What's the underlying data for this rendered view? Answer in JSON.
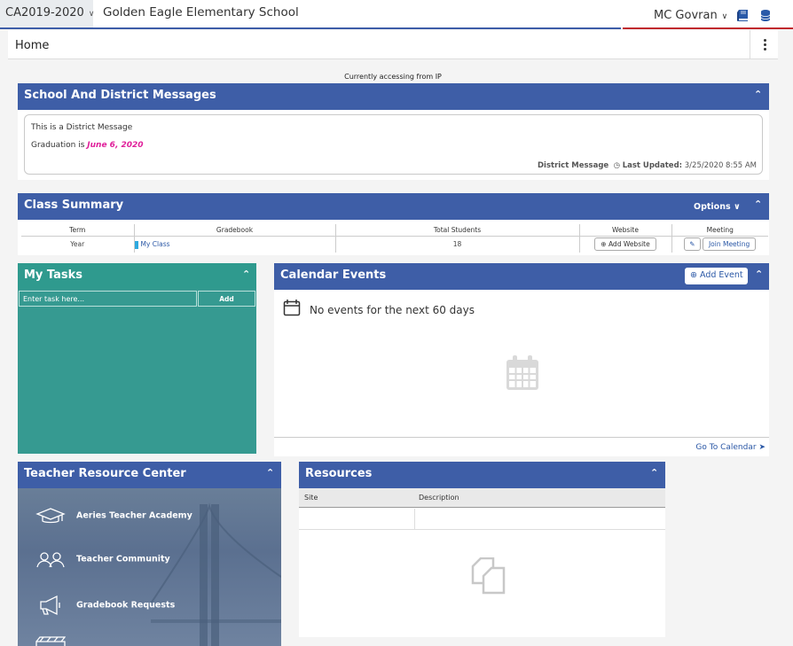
{
  "topbar": {
    "year": "CA2019-2020",
    "school": "Golden Eagle Elementary School",
    "user": "MC Govran",
    "icons": [
      "book-icon",
      "database-icon"
    ],
    "colors": {
      "blue": "#3d5da8",
      "red": "#c0292e"
    }
  },
  "nav": {
    "home": "Home"
  },
  "ip_note": "Currently accessing from IP",
  "messages": {
    "title": "School And District Messages",
    "line1": "This is a District Message",
    "line2_prefix": "Graduation is ",
    "line2_date": "June 6, 2020",
    "footer_label": "District Message",
    "updated_label": "Last Updated:",
    "updated_value": "3/25/2020 8:55 AM"
  },
  "class_summary": {
    "title": "Class Summary",
    "options_label": "Options",
    "columns": [
      "Term",
      "Gradebook",
      "Total Students",
      "Website",
      "Meeting"
    ],
    "rows": [
      {
        "term": "Year",
        "gradebook": "My Class",
        "students": "18",
        "website_btn": "Add Website",
        "meeting_btn": "Join Meeting"
      }
    ]
  },
  "tasks": {
    "title": "My Tasks",
    "placeholder": "Enter task here...",
    "add_label": "Add",
    "color": "#369a91"
  },
  "calendar": {
    "title": "Calendar Events",
    "add_label": "Add Event",
    "empty_text": "No events for the next 60 days",
    "footer_link": "Go To Calendar"
  },
  "trc": {
    "title": "Teacher Resource Center",
    "items": [
      "Aeries Teacher Academy",
      "Teacher Community",
      "Gradebook Requests"
    ]
  },
  "resources": {
    "title": "Resources",
    "columns": [
      "Site",
      "Description"
    ]
  }
}
